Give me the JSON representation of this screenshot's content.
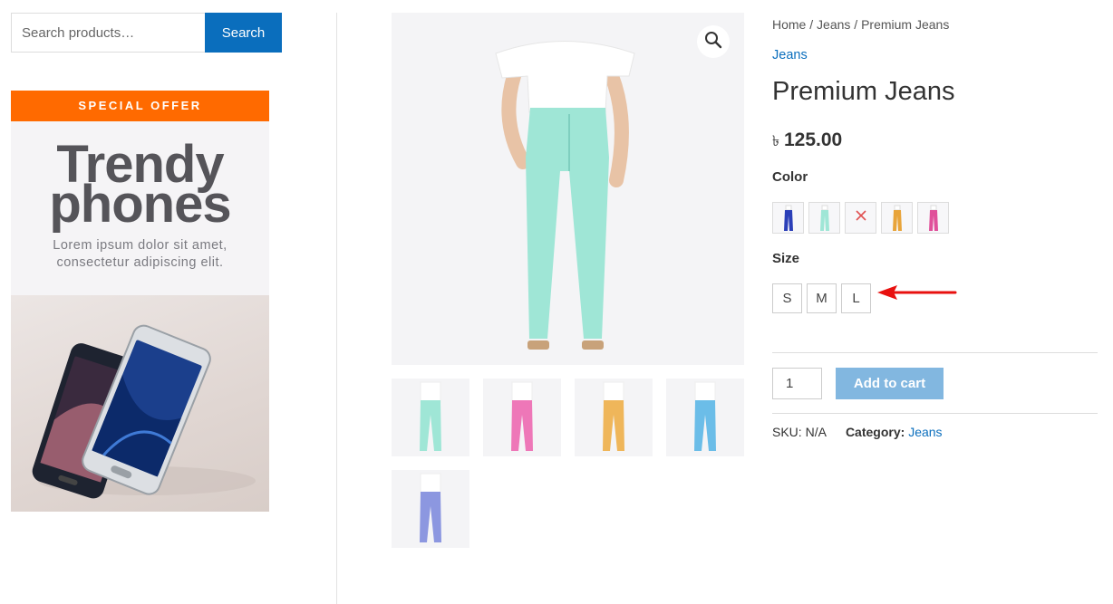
{
  "search": {
    "placeholder": "Search products…",
    "button_label": "Search"
  },
  "promo": {
    "banner": "SPECIAL OFFER",
    "headline_line1": "Trendy",
    "headline_line2": "phones",
    "text_line1": "Lorem ipsum dolor sit amet,",
    "text_line2": "consectetur adipiscing elit.",
    "banner_color": "#ff6a00"
  },
  "breadcrumb": {
    "home": "Home",
    "sep": " / ",
    "category": "Jeans",
    "current": "Premium Jeans"
  },
  "product": {
    "category_link": "Jeans",
    "title": "Premium Jeans",
    "currency": "৳",
    "price": "125.00",
    "color_label": "Color",
    "size_label": "Size",
    "colors": [
      "blue",
      "mint",
      "unavailable",
      "mustard",
      "pink"
    ],
    "color_hex": [
      "#2b3fb8",
      "#9fe6d6",
      "#e05050",
      "#e8a43a",
      "#e0509a"
    ],
    "sizes": [
      "S",
      "M",
      "L"
    ],
    "quantity": "1",
    "add_to_cart": "Add to cart",
    "sku_label": "SKU:",
    "sku_value": "N/A",
    "category_label": "Category:",
    "category_value": "Jeans"
  },
  "thumbnails": [
    "mint",
    "pink",
    "mustard",
    "sky-blue",
    "periwinkle"
  ],
  "thumbnail_colors": [
    "#9fe6d6",
    "#ee77b8",
    "#efb65a",
    "#6bbde8",
    "#8c97e0"
  ],
  "accent_color": "#0a6ebd",
  "annotation_color": "#e8100f"
}
